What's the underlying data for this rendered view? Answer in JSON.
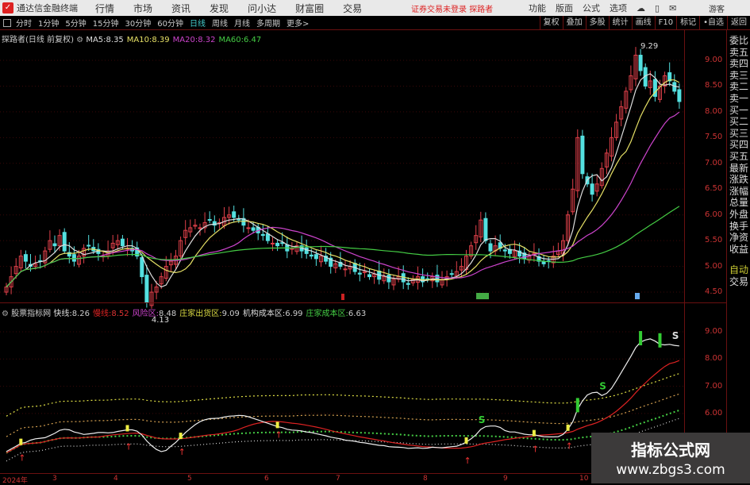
{
  "app": {
    "title": "通达信金融终端",
    "menu": [
      "行情",
      "市场",
      "资讯",
      "发现",
      "问小达",
      "财富圈",
      "交易"
    ],
    "login_status": "证券交易未登录",
    "stock_name_link": "探路者",
    "right_menu": [
      "功能",
      "版面",
      "公式",
      "选项"
    ],
    "guest": "游客"
  },
  "toolbar": {
    "periods": [
      "分时",
      "1分钟",
      "5分钟",
      "15分钟",
      "30分钟",
      "60分钟",
      "日线",
      "周线",
      "月线",
      "多周期",
      "更多>"
    ],
    "active_period": "日线",
    "buttons": [
      "复权",
      "叠加",
      "多股",
      "统计",
      "画线",
      "F10",
      "标记",
      "•自选",
      "返回"
    ]
  },
  "main_chart": {
    "title": "探路者(日线 前复权)",
    "ma": [
      {
        "label": "MA5:",
        "value": "8.35",
        "color": "#dddddd"
      },
      {
        "label": "MA10:",
        "value": "8.39",
        "color": "#e6e066"
      },
      {
        "label": "MA20:",
        "value": "8.32",
        "color": "#cc44cc"
      },
      {
        "label": "MA60:",
        "value": "6.47",
        "color": "#44cc44"
      }
    ],
    "y_ticks": [
      "9.00",
      "8.50",
      "8.00",
      "7.50",
      "7.00",
      "6.50",
      "6.00",
      "5.50",
      "5.00",
      "4.50"
    ],
    "high_label": "9.29",
    "low_label": "4.13",
    "closes": [
      4.6,
      4.8,
      5.0,
      5.2,
      5.1,
      5.0,
      5.05,
      5.1,
      5.3,
      5.5,
      5.4,
      5.6,
      5.3,
      5.2,
      5.1,
      5.2,
      5.35,
      5.4,
      5.3,
      5.25,
      5.2,
      5.3,
      5.45,
      5.5,
      5.4,
      5.35,
      5.3,
      5.2,
      4.8,
      4.3,
      4.5,
      4.6,
      4.8,
      5.0,
      5.1,
      5.2,
      5.5,
      5.7,
      5.75,
      5.8,
      5.75,
      5.85,
      5.9,
      5.8,
      5.85,
      5.95,
      6.0,
      5.95,
      5.9,
      5.8,
      5.75,
      5.7,
      5.65,
      5.6,
      5.5,
      5.45,
      5.4,
      5.45,
      5.3,
      5.35,
      5.4,
      5.3,
      5.25,
      5.2,
      5.15,
      5.2,
      5.1,
      5.0,
      5.05,
      5.0,
      4.95,
      5.0,
      4.9,
      4.85,
      4.9,
      4.8,
      4.85,
      4.75,
      4.8,
      4.7,
      4.75,
      4.8,
      4.7,
      4.65,
      4.75,
      4.8,
      4.7,
      4.75,
      4.8,
      4.7,
      4.75,
      4.8,
      4.85,
      4.9,
      5.0,
      5.2,
      5.4,
      5.6,
      5.9,
      5.5,
      5.3,
      5.4,
      5.35,
      5.3,
      5.25,
      5.3,
      5.2,
      5.15,
      5.2,
      5.25,
      5.1,
      5.05,
      5.1,
      5.2,
      5.3,
      5.5,
      6.0,
      6.5,
      7.5,
      6.8,
      6.6,
      6.4,
      6.6,
      6.9,
      7.2,
      7.5,
      7.8,
      8.1,
      8.4,
      8.7,
      9.1,
      8.8,
      8.5,
      8.6,
      8.3,
      8.5,
      8.7,
      8.6,
      8.4,
      8.2
    ]
  },
  "indicator": {
    "name": "股票指标网",
    "items": [
      {
        "label": "快线:",
        "value": "8.26",
        "color": "#dddddd"
      },
      {
        "label": "慢线:",
        "value": "8.52",
        "color": "#dd2222"
      },
      {
        "label": "风险区:",
        "value": "8.48",
        "color": "#cc44cc"
      },
      {
        "label": "庄家出货区:",
        "value": "9.09",
        "color": "#dddd44"
      },
      {
        "label": "机构成本区:",
        "value": "6.99",
        "color": "#dddddd"
      },
      {
        "label": "庄家成本区:",
        "value": "6.63",
        "color": "#44cc44"
      }
    ],
    "y_ticks": [
      "9.00",
      "8.00",
      "7.00",
      "6.00"
    ]
  },
  "right_panel": [
    "委比",
    "卖五",
    "卖四",
    "卖三",
    "卖二",
    "卖一",
    "买一",
    "买二",
    "买三",
    "买四",
    "买五",
    "最新",
    "涨跌",
    "涨幅",
    "总量",
    "外盘",
    "换手",
    "净资",
    "收益"
  ],
  "right_panel_bottom": [
    "自动",
    "交易"
  ],
  "dates": [
    "2024年",
    "3",
    "4",
    "5",
    "6",
    "7",
    "8",
    "9",
    "10"
  ],
  "watermark": {
    "title": "指标公式网",
    "url": "www.zbgs3.com"
  },
  "colors": {
    "up": "#e0404a",
    "down": "#54e0e0",
    "border": "#6a1010"
  }
}
